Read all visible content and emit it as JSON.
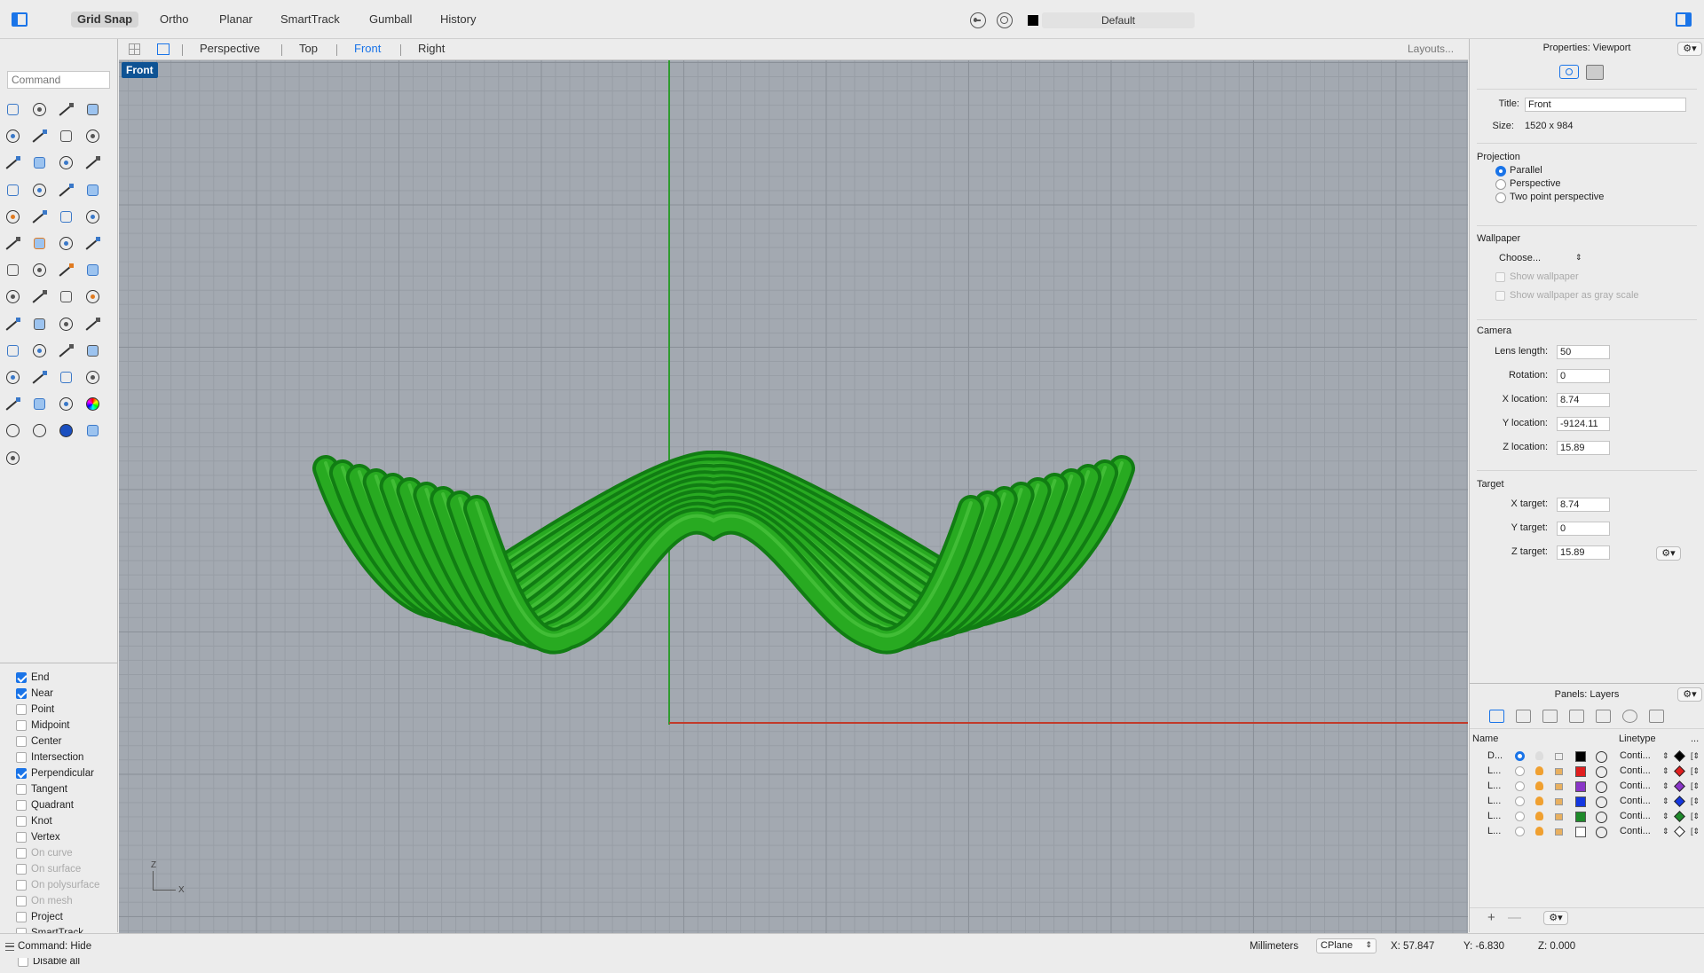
{
  "topbar": {
    "buttons": [
      "Grid Snap",
      "Ortho",
      "Planar",
      "SmartTrack",
      "Gumball",
      "History"
    ],
    "active_button": "Grid Snap",
    "layer_name": "Default"
  },
  "command": {
    "placeholder": "Command"
  },
  "viewport_tabs": {
    "tabs": [
      "Perspective",
      "Top",
      "Front",
      "Right"
    ],
    "active": "Front",
    "layouts_label": "Layouts..."
  },
  "viewport": {
    "label": "Front",
    "axis_z": "Z",
    "axis_x": "X"
  },
  "osnap": {
    "items": [
      {
        "label": "End",
        "checked": true,
        "enabled": true
      },
      {
        "label": "Near",
        "checked": true,
        "enabled": true
      },
      {
        "label": "Point",
        "checked": false,
        "enabled": true
      },
      {
        "label": "Midpoint",
        "checked": false,
        "enabled": true
      },
      {
        "label": "Center",
        "checked": false,
        "enabled": true
      },
      {
        "label": "Intersection",
        "checked": false,
        "enabled": true
      },
      {
        "label": "Perpendicular",
        "checked": true,
        "enabled": true
      },
      {
        "label": "Tangent",
        "checked": false,
        "enabled": true
      },
      {
        "label": "Quadrant",
        "checked": false,
        "enabled": true
      },
      {
        "label": "Knot",
        "checked": false,
        "enabled": true
      },
      {
        "label": "Vertex",
        "checked": false,
        "enabled": true
      },
      {
        "label": "On curve",
        "checked": false,
        "enabled": false
      },
      {
        "label": "On surface",
        "checked": false,
        "enabled": false
      },
      {
        "label": "On polysurface",
        "checked": false,
        "enabled": false
      },
      {
        "label": "On mesh",
        "checked": false,
        "enabled": false
      },
      {
        "label": "Project",
        "checked": false,
        "enabled": true
      },
      {
        "label": "SmartTrack",
        "checked": false,
        "enabled": true
      }
    ],
    "disable_all": "Disable all"
  },
  "properties": {
    "header": "Properties: Viewport",
    "title_label": "Title:",
    "title_value": "Front",
    "size_label": "Size:",
    "size_value": "1520 x 984",
    "projection_heading": "Projection",
    "projection_options": [
      "Parallel",
      "Perspective",
      "Two point perspective"
    ],
    "projection_selected": "Parallel",
    "wallpaper_heading": "Wallpaper",
    "wallpaper_choose": "Choose...",
    "show_wallpaper": "Show wallpaper",
    "show_wallpaper_gray": "Show wallpaper as gray scale",
    "camera_heading": "Camera",
    "lens_label": "Lens length:",
    "lens_value": "50",
    "rotation_label": "Rotation:",
    "rotation_value": "0",
    "xloc_label": "X location:",
    "xloc_value": "8.74",
    "yloc_label": "Y location:",
    "yloc_value": "-9124.11",
    "zloc_label": "Z location:",
    "zloc_value": "15.89",
    "target_heading": "Target",
    "xt_label": "X target:",
    "xt_value": "8.74",
    "yt_label": "Y target:",
    "yt_value": "0",
    "zt_label": "Z target:",
    "zt_value": "15.89"
  },
  "layers": {
    "header": "Panels: Layers",
    "col_name": "Name",
    "col_linetype": "Linetype",
    "col_more": "...",
    "rows": [
      {
        "name": "D...",
        "current": true,
        "color": "#000000",
        "linetype": "Conti..."
      },
      {
        "name": "L...",
        "current": false,
        "color": "#e01e1e",
        "linetype": "Conti..."
      },
      {
        "name": "L...",
        "current": false,
        "color": "#8a35c8",
        "linetype": "Conti..."
      },
      {
        "name": "L...",
        "current": false,
        "color": "#1437e0",
        "linetype": "Conti..."
      },
      {
        "name": "L...",
        "current": false,
        "color": "#1e8a2a",
        "linetype": "Conti..."
      },
      {
        "name": "L...",
        "current": false,
        "color": "#ffffff",
        "linetype": "Conti..."
      }
    ]
  },
  "statusbar": {
    "command": "Command: Hide",
    "units": "Millimeters",
    "cplane": "CPlane",
    "x": "X: 57.847",
    "y": "Y: -6.830",
    "z": "Z: 0.000"
  },
  "colors": {
    "accent": "#1a74e8",
    "object_green": "#2fb01f",
    "viewport_bg": "#a3a9b1"
  }
}
